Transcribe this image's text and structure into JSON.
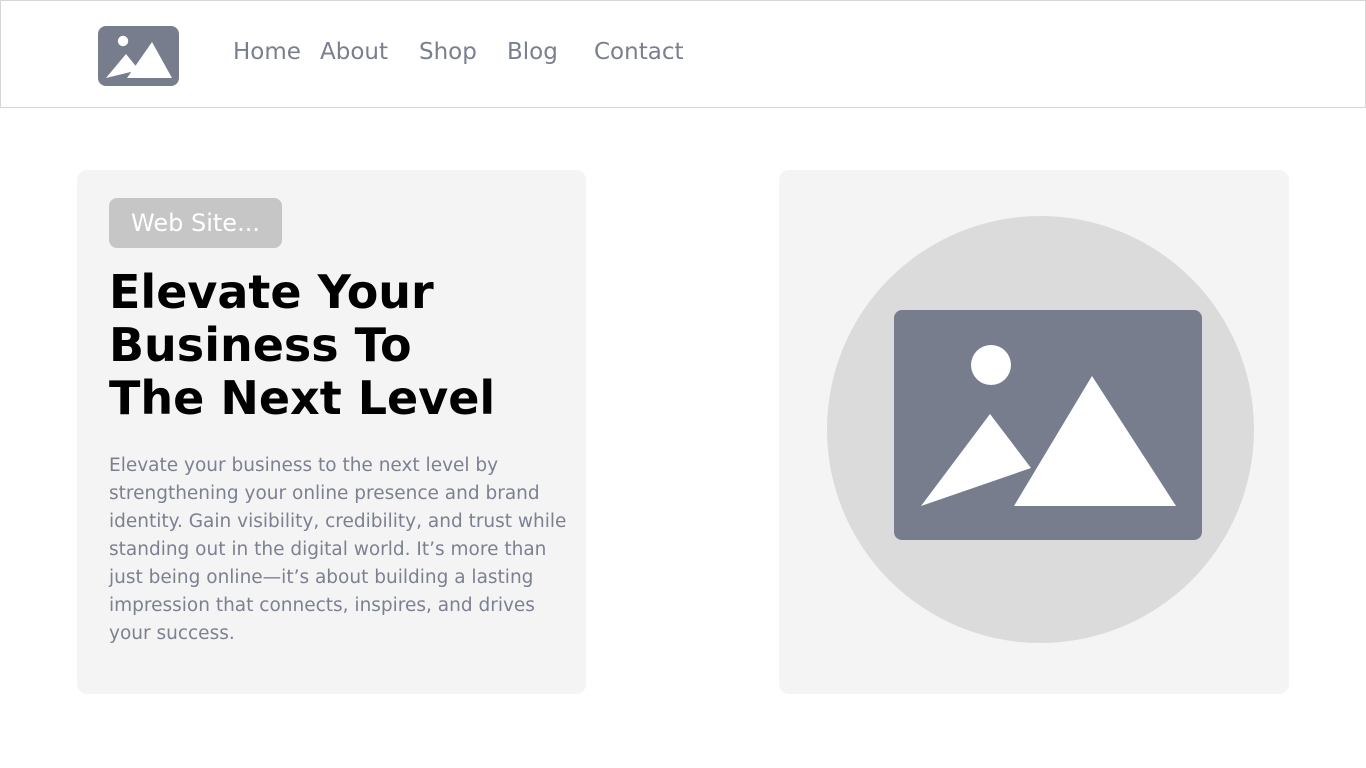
{
  "colors": {
    "accent_gray": "#787d8e",
    "nav_text": "#7a7f90",
    "card_background": "#f4f4f4",
    "badge_background": "#c6c6c6",
    "circle_background": "#dbdbdb",
    "headline": "#000000",
    "body_text": "#7c8192"
  },
  "header": {
    "logo_icon": "image-placeholder-icon",
    "nav": {
      "home": "Home",
      "about": "About",
      "shop": "Shop",
      "blog": "Blog",
      "contact": "Contact"
    }
  },
  "hero": {
    "badge": "Web Site...",
    "headline_lines": [
      "Elevate Your",
      "Business To",
      "The Next Level"
    ],
    "description_lines": [
      "Elevate your business to the next level by",
      "strengthening your online presence and brand",
      "identity. Gain visibility, credibility, and trust while",
      "standing out in the digital world. It’s more than",
      "just being online—it’s about building a lasting",
      "impression that connects, inspires, and drives",
      "your success."
    ],
    "image_icon": "image-placeholder-icon"
  }
}
